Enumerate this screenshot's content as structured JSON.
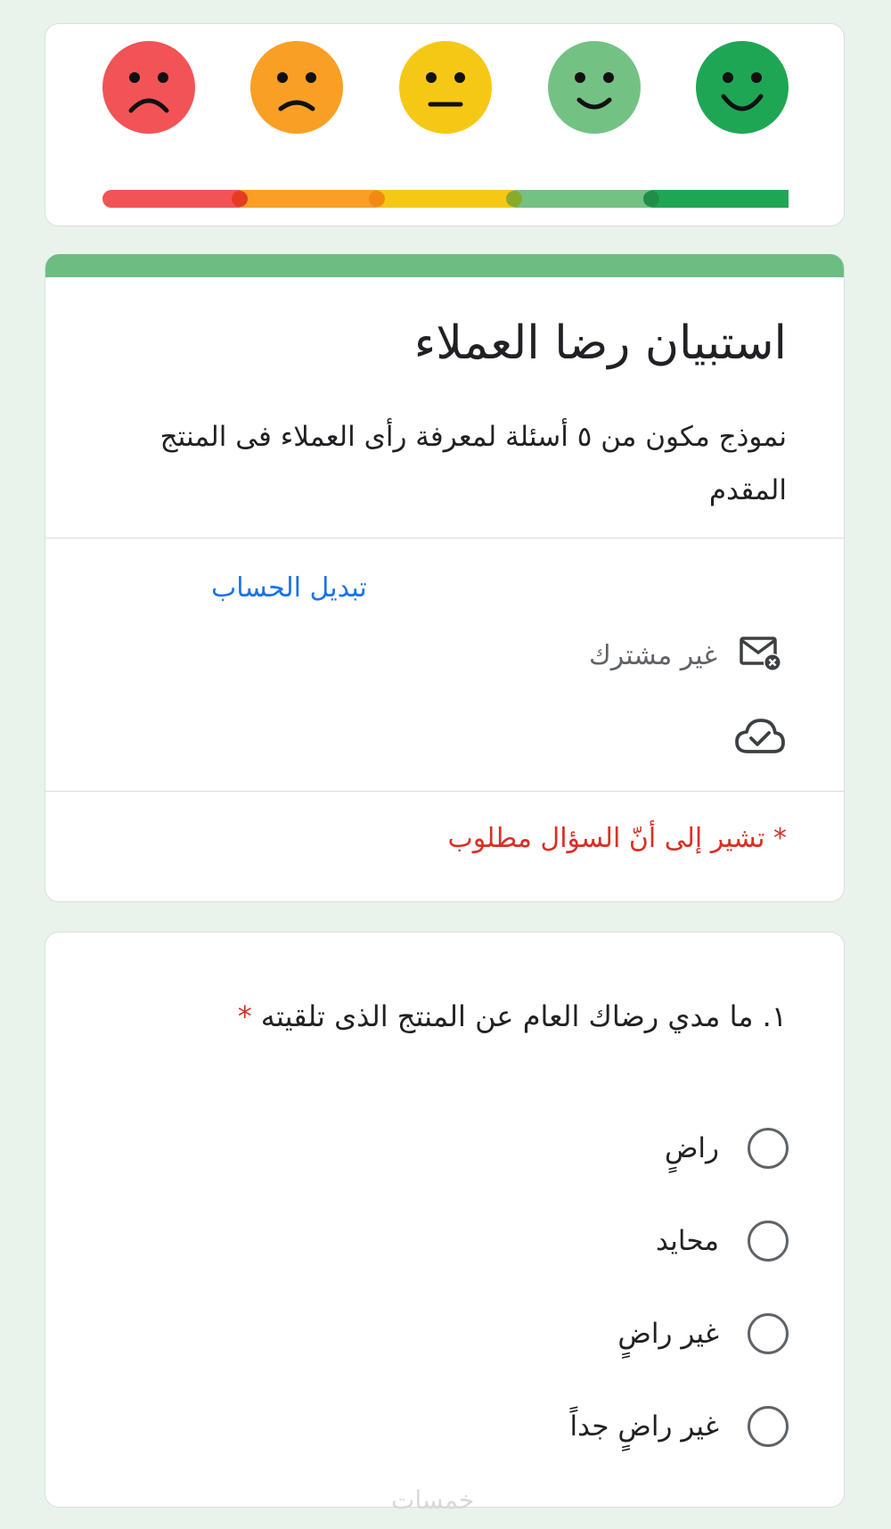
{
  "colors": {
    "background": "#e8f3ec",
    "accent_green": "#6dbd83",
    "link_blue": "#1a73e8",
    "required_red": "#d93025",
    "face_very_sad": "#f25356",
    "face_sad": "#f99f24",
    "face_neutral": "#f6c816",
    "face_happy": "#74c184",
    "face_very_happy": "#1fa655"
  },
  "rating_faces": [
    {
      "icon": "very-sad-face-icon",
      "color": "#f25356",
      "mouth": "frown-deep"
    },
    {
      "icon": "sad-face-icon",
      "color": "#f99f24",
      "mouth": "frown"
    },
    {
      "icon": "neutral-face-icon",
      "color": "#f6c816",
      "mouth": "flat"
    },
    {
      "icon": "happy-face-icon",
      "color": "#74c184",
      "mouth": "smile"
    },
    {
      "icon": "very-happy-face-icon",
      "color": "#1fa655",
      "mouth": "smile-big"
    }
  ],
  "rating_scale": {
    "segments": [
      "#f25356",
      "#f99f24",
      "#f6c816",
      "#74c184",
      "#1fa655"
    ],
    "markers": [
      "#e63b23",
      "#f08a14",
      "#8aab2a",
      "#1f8f48"
    ]
  },
  "form": {
    "title": "استبيان رضا العملاء",
    "description": "نموذج مكون من ٥ أسئلة لمعرفة رأى العملاء فى المنتج المقدم",
    "switch_account": "تبديل الحساب",
    "not_shared": "غير مشترك",
    "not_shared_icon": "mail-off-icon",
    "saved_icon": "cloud-check-icon",
    "required_note": "* تشير إلى أنّ السؤال مطلوب"
  },
  "question": {
    "title": "١. ما مدي رضاك العام عن المنتج الذى تلقيته",
    "required_mark": "*",
    "options": [
      "راضٍ",
      "محايد",
      "غير راضٍ",
      "غير راضٍ جداً"
    ]
  },
  "watermark": "خمسات"
}
